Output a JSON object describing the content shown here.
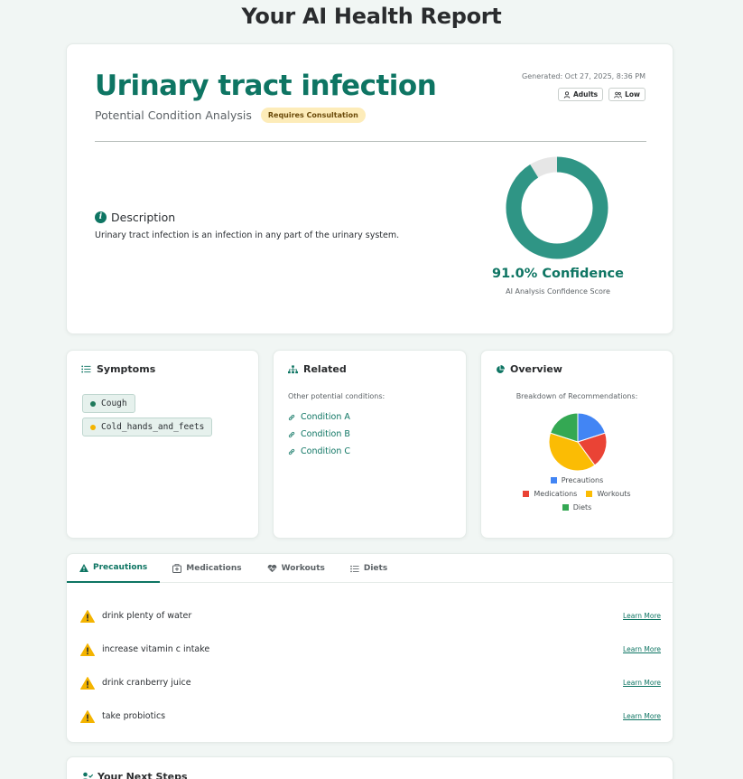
{
  "page": {
    "title": "Your AI Health Report"
  },
  "hero": {
    "condition": "Urinary tract infection",
    "subtitle": "Potential Condition Analysis",
    "badge": "Requires Consultation",
    "generated": "Generated: Oct 27, 2025, 8:36 PM",
    "tags": [
      {
        "label": "Adults",
        "icon": "person-icon"
      },
      {
        "label": "Low",
        "icon": "people-icon"
      }
    ],
    "description_heading": "Description",
    "description": "Urinary tract infection is an infection in any part of the urinary system.",
    "confidence_value": 0.91,
    "confidence_text": "91.0% Confidence",
    "confidence_label": "AI Analysis Confidence Score"
  },
  "symptoms": {
    "heading": "Symptoms",
    "items": [
      {
        "label": "Cough",
        "color": "#1f7a5c"
      },
      {
        "label": "Cold_hands_and_feets",
        "color": "#f4b400"
      }
    ]
  },
  "related": {
    "heading": "Related",
    "subtitle": "Other potential conditions:",
    "items": [
      "Condition A",
      "Condition B",
      "Condition C"
    ]
  },
  "overview": {
    "heading": "Overview",
    "subtitle": "Breakdown of Recommendations:",
    "chart_data": {
      "type": "pie",
      "categories": [
        "Precautions",
        "Medications",
        "Workouts",
        "Diets"
      ],
      "values": [
        4,
        4,
        8,
        4
      ],
      "colors": [
        "#4285f4",
        "#ea4335",
        "#fbbc04",
        "#34a853"
      ]
    }
  },
  "tabs": {
    "items": [
      {
        "label": "Precautions",
        "icon": "warning-icon",
        "active": true
      },
      {
        "label": "Medications",
        "icon": "medkit-icon",
        "active": false
      },
      {
        "label": "Workouts",
        "icon": "heartbeat-icon",
        "active": false
      },
      {
        "label": "Diets",
        "icon": "list-icon",
        "active": false
      }
    ],
    "precautions": [
      "drink plenty of water",
      "increase vitamin c intake",
      "drink cranberry juice",
      "take probiotics"
    ],
    "learn_more": "Learn More"
  },
  "next_steps": {
    "heading": "Your Next Steps"
  },
  "colors": {
    "accent": "#0e7563",
    "donut": "#2f9585",
    "donut_track": "#e6e6e6"
  }
}
